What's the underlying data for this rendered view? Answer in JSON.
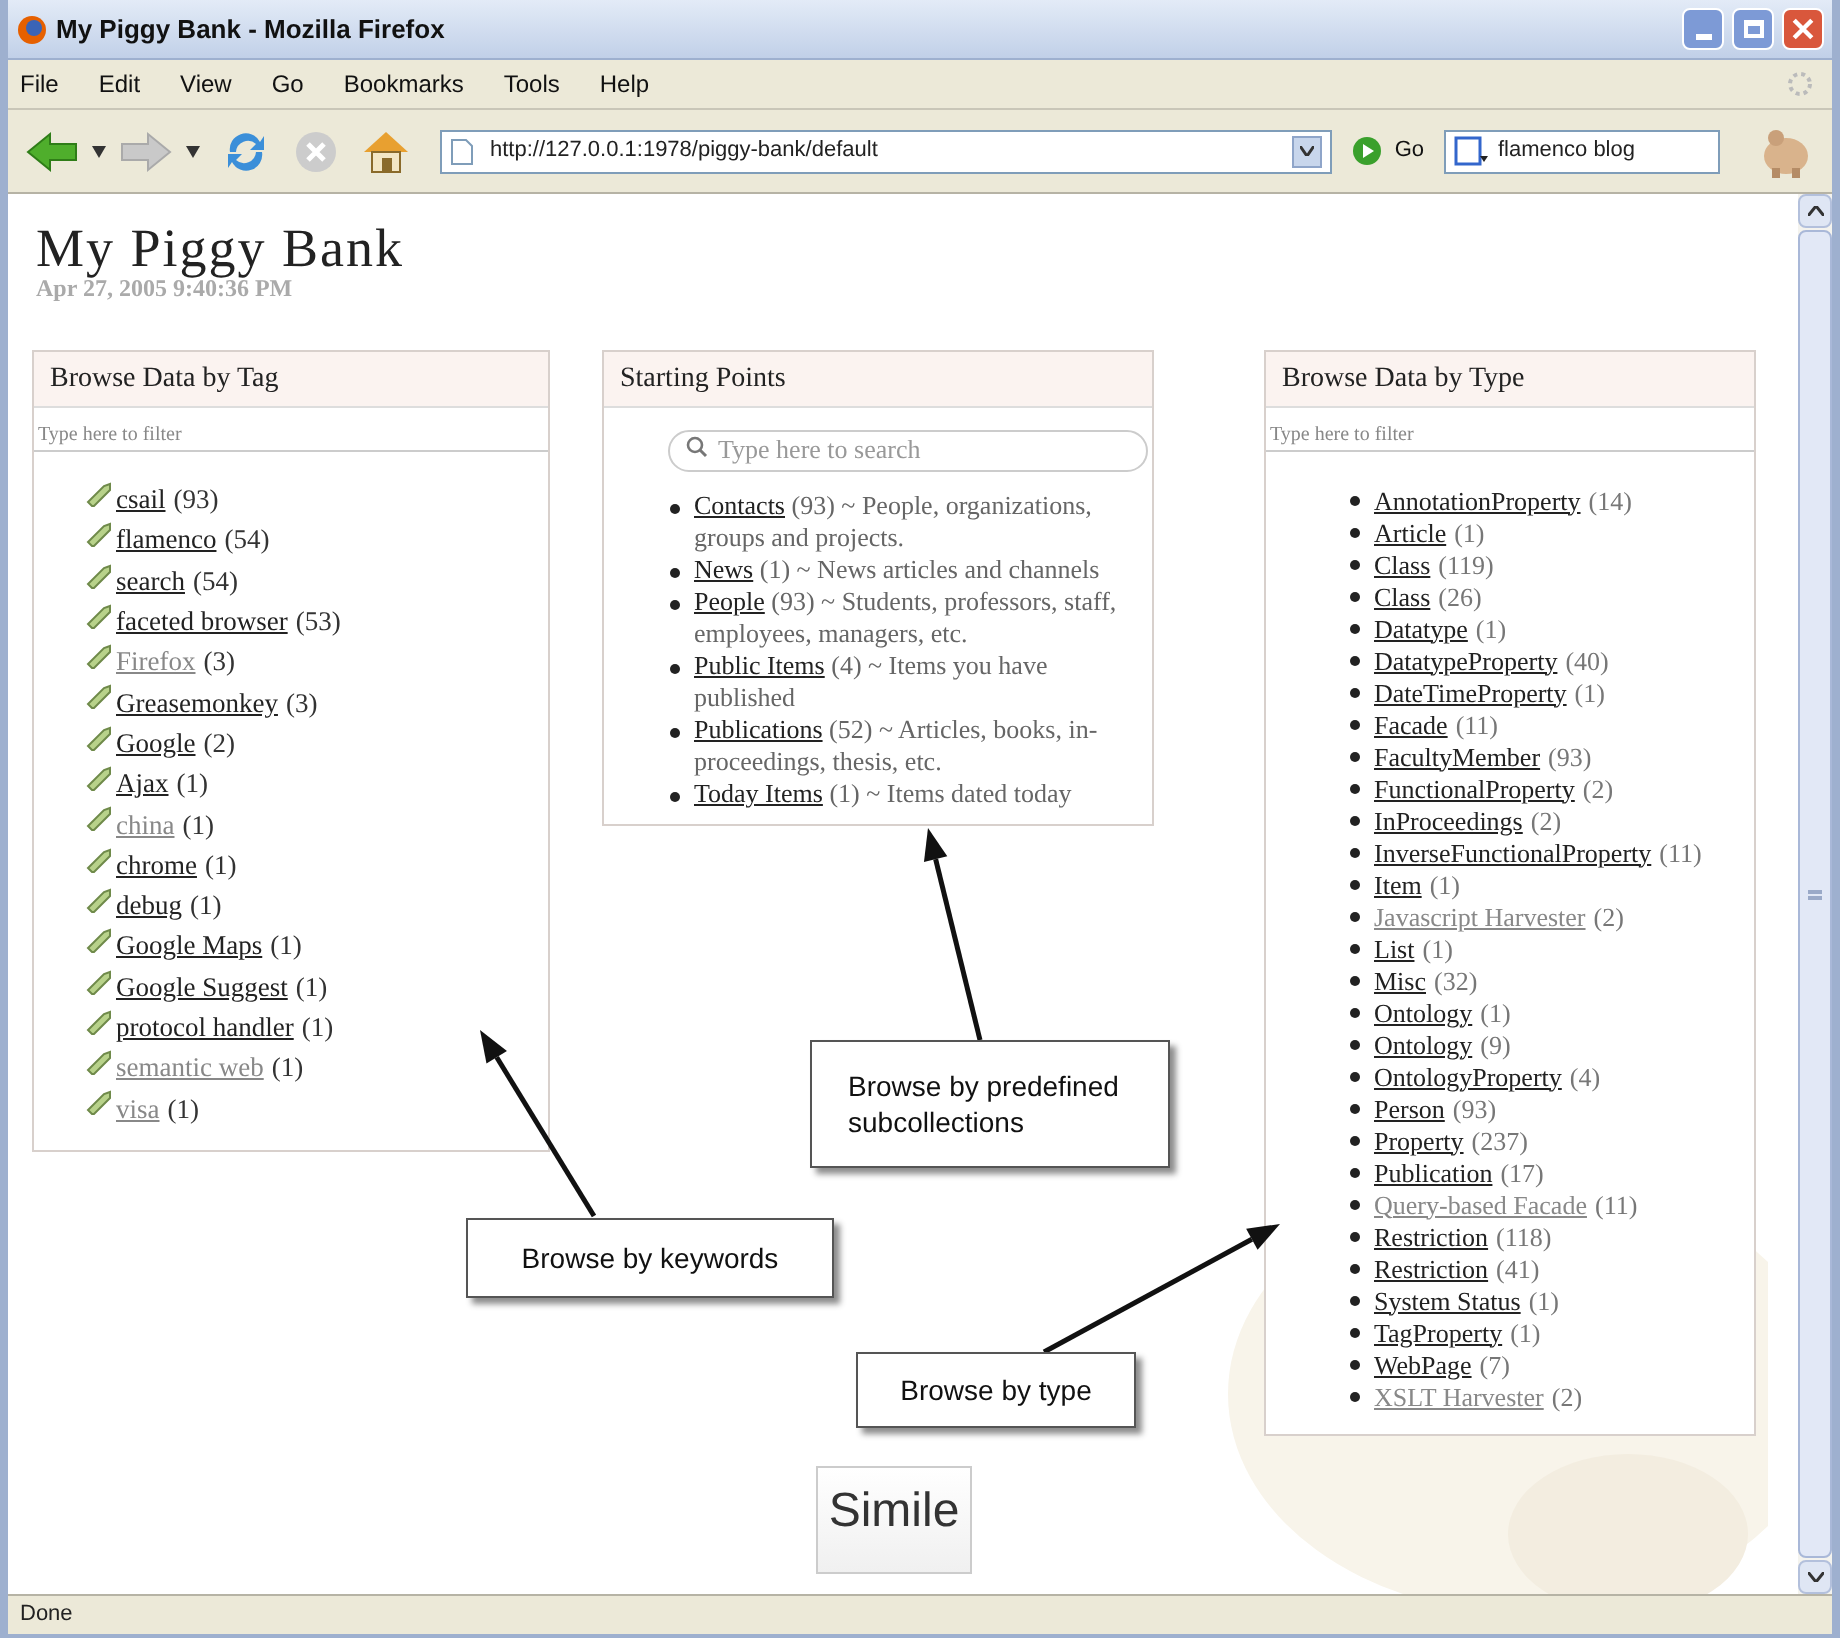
{
  "window": {
    "title": "My Piggy Bank - Mozilla Firefox"
  },
  "menu": [
    "File",
    "Edit",
    "View",
    "Go",
    "Bookmarks",
    "Tools",
    "Help"
  ],
  "toolbar": {
    "url": "http://127.0.0.1:1978/piggy-bank/default",
    "go_label": "Go",
    "search_value": "flamenco blog"
  },
  "page": {
    "title": "My Piggy Bank",
    "timestamp": "Apr 27, 2005 9:40:36 PM"
  },
  "tag_panel": {
    "heading": "Browse Data by Tag",
    "filter_placeholder": "Type here to filter",
    "tags": [
      {
        "label": "csail",
        "count": "(93)",
        "dimmed": false
      },
      {
        "label": "flamenco",
        "count": "(54)",
        "dimmed": false
      },
      {
        "label": "search",
        "count": "(54)",
        "dimmed": false
      },
      {
        "label": "faceted browser",
        "count": "(53)",
        "dimmed": false
      },
      {
        "label": "Firefox",
        "count": "(3)",
        "dimmed": true
      },
      {
        "label": "Greasemonkey",
        "count": "(3)",
        "dimmed": false
      },
      {
        "label": "Google",
        "count": "(2)",
        "dimmed": false
      },
      {
        "label": "Ajax",
        "count": "(1)",
        "dimmed": false
      },
      {
        "label": "china",
        "count": "(1)",
        "dimmed": true
      },
      {
        "label": "chrome",
        "count": "(1)",
        "dimmed": false
      },
      {
        "label": "debug",
        "count": "(1)",
        "dimmed": false
      },
      {
        "label": "Google Maps",
        "count": "(1)",
        "dimmed": false
      },
      {
        "label": "Google Suggest",
        "count": "(1)",
        "dimmed": false
      },
      {
        "label": "protocol handler",
        "count": "(1)",
        "dimmed": false
      },
      {
        "label": "semantic web",
        "count": "(1)",
        "dimmed": true
      },
      {
        "label": "visa",
        "count": "(1)",
        "dimmed": true
      }
    ]
  },
  "starting_points": {
    "heading": "Starting Points",
    "search_placeholder": "Type here to search",
    "items": [
      {
        "label": "Contacts",
        "description": "(93) ~ People, organizations, groups and projects."
      },
      {
        "label": "News",
        "description": "(1) ~ News articles and channels"
      },
      {
        "label": "People",
        "description": "(93) ~ Students, professors, staff, employees, managers, etc."
      },
      {
        "label": "Public Items",
        "description": "(4) ~ Items you have published"
      },
      {
        "label": "Publications",
        "description": "(52) ~ Articles, books, in-proceedings, thesis, etc."
      },
      {
        "label": "Today Items",
        "description": "(1) ~ Items dated today"
      }
    ]
  },
  "type_panel": {
    "heading": "Browse Data by Type",
    "filter_placeholder": "Type here to filter",
    "types": [
      {
        "label": "AnnotationProperty",
        "count": "(14)",
        "dimmed": false
      },
      {
        "label": "Article",
        "count": "(1)",
        "dimmed": false
      },
      {
        "label": "Class",
        "count": "(119)",
        "dimmed": false
      },
      {
        "label": "Class",
        "count": "(26)",
        "dimmed": false
      },
      {
        "label": "Datatype",
        "count": "(1)",
        "dimmed": false
      },
      {
        "label": "DatatypeProperty",
        "count": "(40)",
        "dimmed": false
      },
      {
        "label": "DateTimeProperty",
        "count": "(1)",
        "dimmed": false
      },
      {
        "label": "Facade",
        "count": "(11)",
        "dimmed": false
      },
      {
        "label": "FacultyMember",
        "count": "(93)",
        "dimmed": false
      },
      {
        "label": "FunctionalProperty",
        "count": "(2)",
        "dimmed": false
      },
      {
        "label": "InProceedings",
        "count": "(2)",
        "dimmed": false
      },
      {
        "label": "InverseFunctionalProperty",
        "count": "(11)",
        "dimmed": false
      },
      {
        "label": "Item",
        "count": "(1)",
        "dimmed": false
      },
      {
        "label": "Javascript Harvester",
        "count": "(2)",
        "dimmed": true
      },
      {
        "label": "List",
        "count": "(1)",
        "dimmed": false
      },
      {
        "label": "Misc",
        "count": "(32)",
        "dimmed": false
      },
      {
        "label": "Ontology",
        "count": "(1)",
        "dimmed": false
      },
      {
        "label": "Ontology",
        "count": "(9)",
        "dimmed": false
      },
      {
        "label": "OntologyProperty",
        "count": "(4)",
        "dimmed": false
      },
      {
        "label": "Person",
        "count": "(93)",
        "dimmed": false
      },
      {
        "label": "Property",
        "count": "(237)",
        "dimmed": false
      },
      {
        "label": "Publication",
        "count": "(17)",
        "dimmed": false
      },
      {
        "label": "Query-based Facade",
        "count": "(11)",
        "dimmed": true
      },
      {
        "label": "Restriction",
        "count": "(118)",
        "dimmed": false
      },
      {
        "label": "Restriction",
        "count": "(41)",
        "dimmed": false
      },
      {
        "label": "System Status",
        "count": "(1)",
        "dimmed": false
      },
      {
        "label": "TagProperty",
        "count": "(1)",
        "dimmed": false
      },
      {
        "label": "WebPage",
        "count": "(7)",
        "dimmed": false
      },
      {
        "label": "XSLT Harvester",
        "count": "(2)",
        "dimmed": true
      }
    ]
  },
  "footer_logo": "Simile",
  "annotations": [
    {
      "text": "Browse by keywords"
    },
    {
      "text": "Browse by predefined subcollections"
    },
    {
      "text": "Browse by type"
    }
  ],
  "status_bar": "Done"
}
